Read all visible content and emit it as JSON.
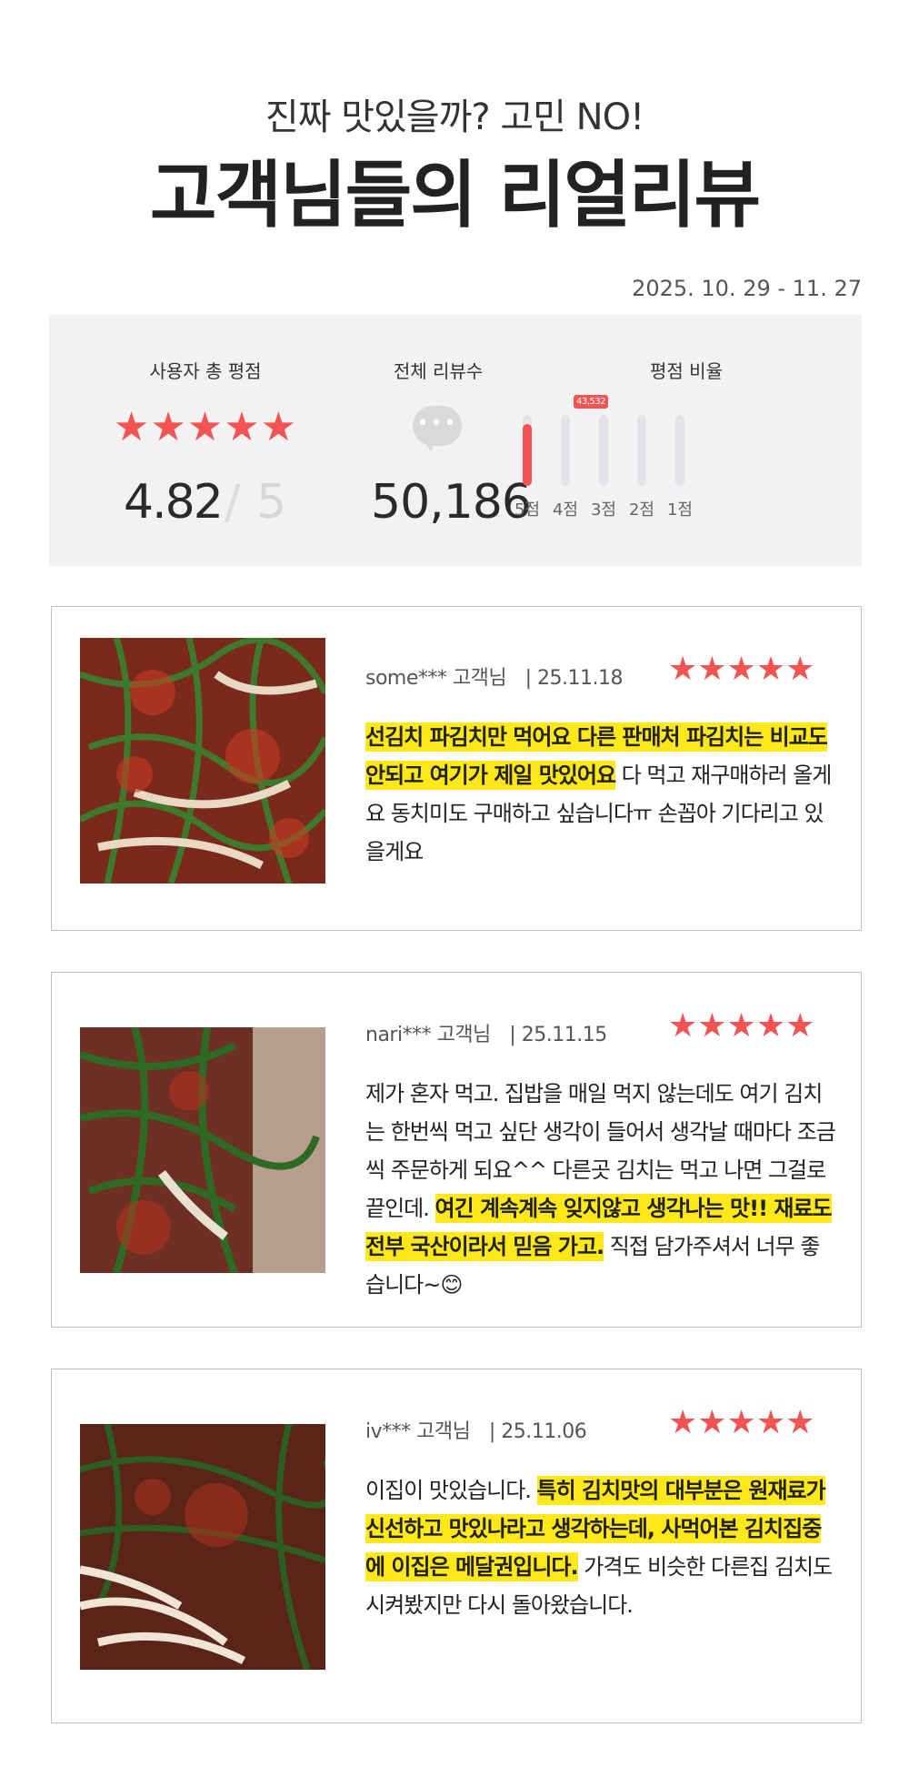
{
  "header": {
    "subtitle": "진짜 맛있을까? 고민 NO!",
    "title": "고객님들의 리얼리뷰"
  },
  "date_range": "2025. 10. 29 - 11. 27",
  "summary": {
    "total_rating_label": "사용자 총 평점",
    "stars": "★★★★★",
    "rating": "4.82",
    "rating_separator": "/",
    "rating_max": "5",
    "review_count_label": "전체 리뷰수",
    "review_count": "50,186",
    "ratio_label": "평점 비율",
    "ratio_badge": "43,532",
    "ratio_bars": [
      {
        "label": "5점",
        "fraction": 0.87
      },
      {
        "label": "4점",
        "fraction": 0
      },
      {
        "label": "3점",
        "fraction": 0
      },
      {
        "label": "2점",
        "fraction": 0
      },
      {
        "label": "1점",
        "fraction": 0
      }
    ],
    "colors": {
      "accent": "#f25353",
      "track": "#e3e4eb",
      "panel": "#f2f2f2"
    }
  },
  "reviews": [
    {
      "user": "some*** 고객님",
      "divider": "|",
      "date": "25.11.18",
      "stars": "★★★★★",
      "segments": [
        {
          "text": "선김치 파김치만 먹어요 다른 판매처 파김치는 비교도 안되고 여기가 제일 맛있어요",
          "highlight": true
        },
        {
          "text": " 다 먹고 재구매하러 올게요 동치미도 구매하고 싶습니다ㅠ 손꼽아 기다리고 있을게요",
          "highlight": false
        }
      ]
    },
    {
      "user": "nari*** 고객님",
      "divider": "|",
      "date": "25.11.15",
      "stars": "★★★★★",
      "segments": [
        {
          "text": "제가 혼자 먹고. 집밥을 매일 먹지 않는데도 여기 김치는 한번씩 먹고 싶단 생각이 들어서 생각날 때마다 조금씩 주문하게 되요^^ 다른곳 김치는 먹고 나면 그걸로 끝인데. ",
          "highlight": false
        },
        {
          "text": "여긴 계속계속 잊지않고 생각나는 맛!! 재료도 전부 국산이라서 믿음 가고.",
          "highlight": true
        },
        {
          "text": " 직접 담가주셔서 너무 좋습니다~😊",
          "highlight": false
        }
      ]
    },
    {
      "user": "iv*** 고객님",
      "divider": "|",
      "date": "25.11.06",
      "stars": "★★★★★",
      "segments": [
        {
          "text": "이집이 맛있습니다. ",
          "highlight": false
        },
        {
          "text": "특히 김치맛의 대부분은 원재료가 신선하고 맛있나라고 생각하는데, 사먹어본 김치집중에 이집은 메달권입니다.",
          "highlight": true
        },
        {
          "text": " 가격도 비슷한 다른집 김치도 시켜봤지만 다시 돌아왔습니다.",
          "highlight": false
        }
      ]
    }
  ]
}
